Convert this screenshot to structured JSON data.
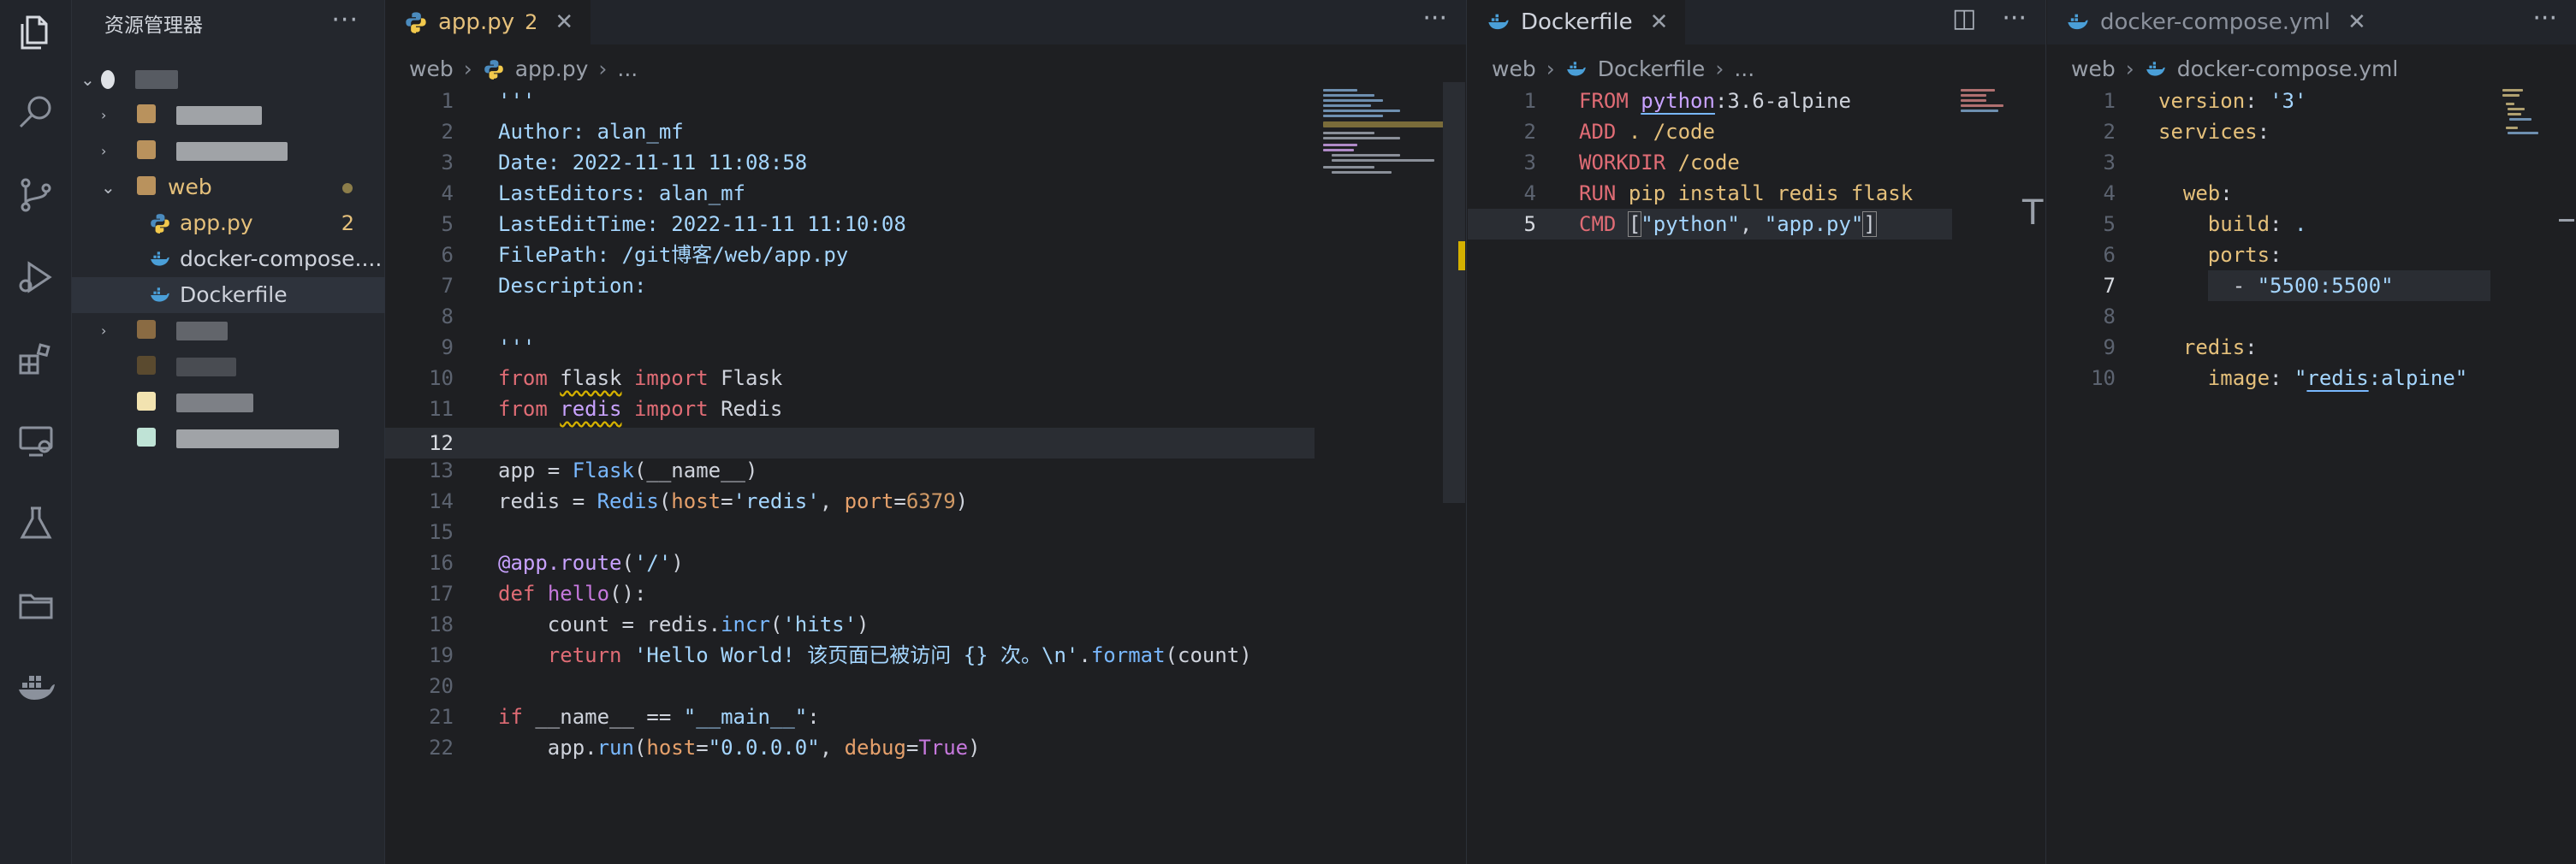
{
  "sidebar": {
    "title": "资源管理器",
    "more": "···",
    "folder_web": "web",
    "files": [
      "app.py",
      "docker-compose....",
      "Dockerfile"
    ],
    "app_badge": "2"
  },
  "editor1": {
    "tab": {
      "label": "app.py",
      "badge": "2",
      "close": "✕"
    },
    "more": "···",
    "breadcrumb": [
      "web",
      "app.py",
      "..."
    ],
    "current_line": 12
  },
  "editor2": {
    "tab": {
      "label": "Dockerfile",
      "close": "✕"
    },
    "split": "◫",
    "more": "···",
    "breadcrumb": [
      "web",
      "Dockerfile",
      "..."
    ],
    "current_line": 5
  },
  "editor3": {
    "tab": {
      "label": "docker-compose.yml",
      "close": "✕"
    },
    "more": "···",
    "breadcrumb": [
      "web",
      "docker-compose.yml"
    ],
    "current_line": 7
  },
  "colors": {
    "accent": "#d4b000",
    "modified": "#e5c07b",
    "background": "#1e1f22"
  }
}
